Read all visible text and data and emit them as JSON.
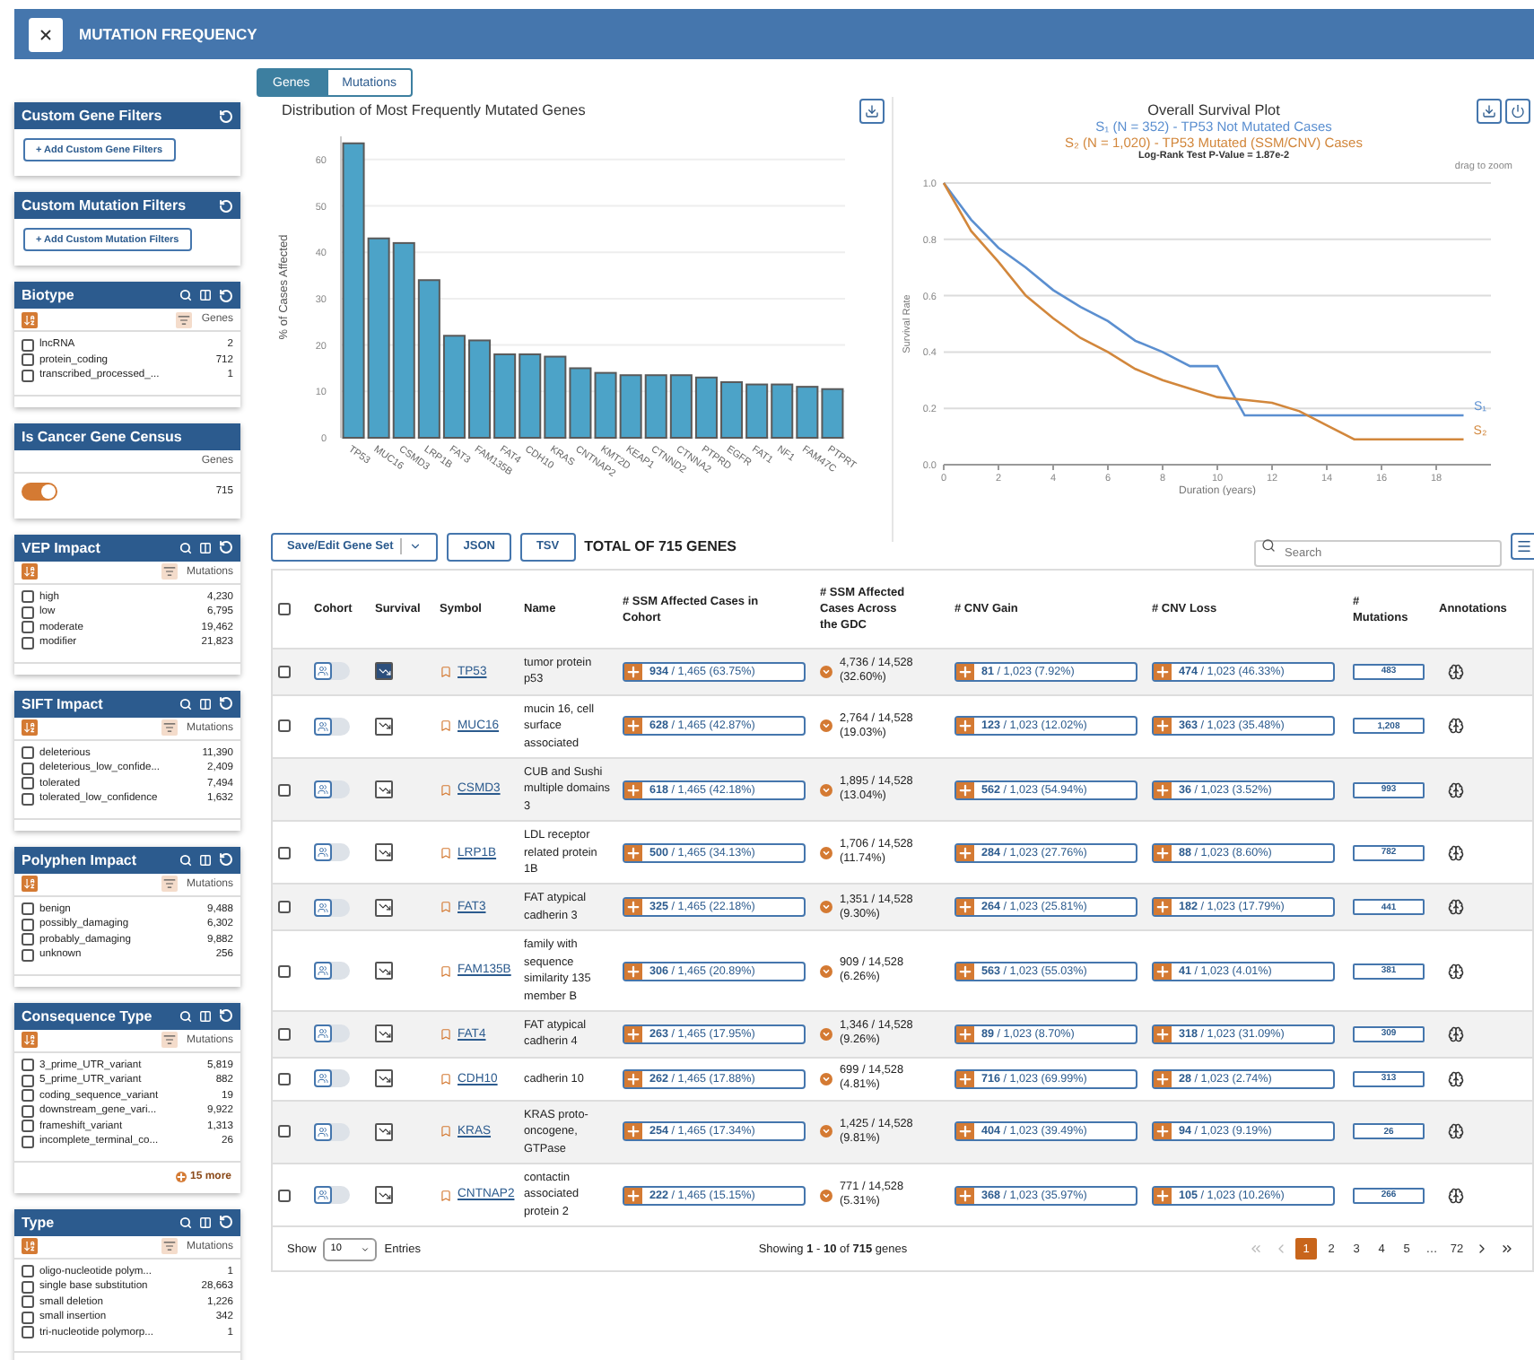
{
  "header": {
    "title": "MUTATION FREQUENCY"
  },
  "sidebar": {
    "cards": [
      {
        "kind": "custom",
        "title": "Custom Gene Filters",
        "button": "+ Add Custom Gene Filters"
      },
      {
        "kind": "custom",
        "title": "Custom Mutation Filters",
        "button": "+ Add Custom Mutation Filters"
      },
      {
        "kind": "facet",
        "title": "Biotype",
        "count_label": "Genes",
        "items": [
          {
            "label": "lncRNA",
            "count": "2",
            "checked": false
          },
          {
            "label": "protein_coding",
            "count": "712",
            "checked": false
          },
          {
            "label": "transcribed_processed_...",
            "count": "1",
            "checked": false
          }
        ]
      },
      {
        "kind": "toggle",
        "title": "Is Cancer Gene Census",
        "count_label": "Genes",
        "on": true,
        "count": "715"
      },
      {
        "kind": "facet",
        "title": "VEP Impact",
        "count_label": "Mutations",
        "items": [
          {
            "label": "high",
            "count": "4,230",
            "checked": false
          },
          {
            "label": "low",
            "count": "6,795",
            "checked": false
          },
          {
            "label": "moderate",
            "count": "19,462",
            "checked": false
          },
          {
            "label": "modifier",
            "count": "21,823",
            "checked": false
          }
        ]
      },
      {
        "kind": "facet",
        "title": "SIFT Impact",
        "count_label": "Mutations",
        "items": [
          {
            "label": "deleterious",
            "count": "11,390",
            "checked": false
          },
          {
            "label": "deleterious_low_confide...",
            "count": "2,409",
            "checked": false
          },
          {
            "label": "tolerated",
            "count": "7,494",
            "checked": false
          },
          {
            "label": "tolerated_low_confidence",
            "count": "1,632",
            "checked": false
          }
        ]
      },
      {
        "kind": "facet",
        "title": "Polyphen Impact",
        "count_label": "Mutations",
        "items": [
          {
            "label": "benign",
            "count": "9,488",
            "checked": false
          },
          {
            "label": "possibly_damaging",
            "count": "6,302",
            "checked": false
          },
          {
            "label": "probably_damaging",
            "count": "9,882",
            "checked": false
          },
          {
            "label": "unknown",
            "count": "256",
            "checked": false
          }
        ]
      },
      {
        "kind": "facet",
        "title": "Consequence Type",
        "count_label": "Mutations",
        "more": "15 more",
        "items": [
          {
            "label": "3_prime_UTR_variant",
            "count": "5,819",
            "checked": false
          },
          {
            "label": "5_prime_UTR_variant",
            "count": "882",
            "checked": false
          },
          {
            "label": "coding_sequence_variant",
            "count": "19",
            "checked": false
          },
          {
            "label": "downstream_gene_vari...",
            "count": "9,922",
            "checked": false
          },
          {
            "label": "frameshift_variant",
            "count": "1,313",
            "checked": false
          },
          {
            "label": "incomplete_terminal_co...",
            "count": "26",
            "checked": false
          }
        ]
      },
      {
        "kind": "facet",
        "title": "Type",
        "count_label": "Mutations",
        "items": [
          {
            "label": "oligo-nucleotide polym...",
            "count": "1",
            "checked": false
          },
          {
            "label": "single base substitution",
            "count": "28,663",
            "checked": false
          },
          {
            "label": "small deletion",
            "count": "1,226",
            "checked": false
          },
          {
            "label": "small insertion",
            "count": "342",
            "checked": false
          },
          {
            "label": "tri-nucleotide polymorp...",
            "count": "1",
            "checked": false
          }
        ]
      }
    ]
  },
  "view_tabs": [
    {
      "label": "Genes",
      "selected": true
    },
    {
      "label": "Mutations",
      "selected": false
    }
  ],
  "gene_chart": {
    "chart_data": {
      "type": "bar",
      "title": "Distribution of Most Frequently Mutated Genes",
      "ylabel": "% of Cases Affected",
      "categories": [
        "TP53",
        "MUC16",
        "CSMD3",
        "LRP1B",
        "FAT3",
        "FAM135B",
        "FAT4",
        "CDH10",
        "KRAS",
        "CNTNAP2",
        "KMT2D",
        "KEAP1",
        "CTNND2",
        "CTNNA2",
        "PTPRD",
        "EGFR",
        "FAT1",
        "NF1",
        "FAM47C",
        "PTPRT"
      ],
      "values": [
        63.5,
        43,
        42,
        34,
        22,
        21,
        18,
        18,
        17.5,
        15,
        14,
        13.5,
        13.5,
        13.5,
        13,
        12,
        11.5,
        11.5,
        11,
        10.5
      ],
      "ylim": [
        0,
        65
      ],
      "grid": true,
      "yticks": [
        0,
        10,
        20,
        30,
        40,
        50,
        60
      ]
    }
  },
  "survival": {
    "legend": [
      {
        "text": "S₁ (N = 352) - TP53 Not Mutated Cases",
        "color": "#5b8fd0"
      },
      {
        "text": "S₂ (N = 1,020) - TP53 Mutated (SSM/CNV) Cases",
        "color": "#d2873c"
      }
    ],
    "p_value": "Log-Rank Test P-Value = 1.87e-2",
    "hint": "drag to zoom",
    "chart_data": {
      "type": "line",
      "title": "Overall Survival Plot",
      "xlabel": "Duration (years)",
      "ylabel": "Survival Rate",
      "x": [
        0,
        1,
        2,
        3,
        4,
        5,
        6,
        7,
        8,
        9,
        10,
        11,
        12,
        13,
        14,
        15,
        16,
        17,
        18,
        19
      ],
      "series": [
        {
          "name": "S₁",
          "color": "#5b8fd0",
          "values": [
            1.0,
            0.87,
            0.77,
            0.7,
            0.62,
            0.56,
            0.51,
            0.44,
            0.4,
            0.35,
            0.35,
            0.175,
            0.175,
            0.175,
            0.175,
            0.175,
            0.175,
            0.175,
            0.175,
            0.175
          ]
        },
        {
          "name": "S₂",
          "color": "#d2873c",
          "values": [
            1.0,
            0.83,
            0.72,
            0.6,
            0.52,
            0.45,
            0.4,
            0.34,
            0.3,
            0.27,
            0.24,
            0.23,
            0.22,
            0.19,
            0.14,
            0.09,
            0.09,
            0.09,
            0.09,
            0.09
          ]
        }
      ],
      "xlim": [
        0,
        20
      ],
      "ylim": [
        0,
        1
      ],
      "grid": true,
      "xticks": [
        0,
        2,
        4,
        6,
        8,
        10,
        12,
        14,
        16,
        18
      ],
      "yticks": [
        {
          "value": 0,
          "label": "0.0"
        },
        {
          "value": 0.2,
          "label": "0.2"
        },
        {
          "value": 0.4,
          "label": "0.4"
        },
        {
          "value": 0.6,
          "label": "0.6"
        },
        {
          "value": 0.8,
          "label": "0.8"
        },
        {
          "value": 1,
          "label": "1.0"
        }
      ]
    }
  },
  "toolbar": {
    "gene_set_button": "Save/Edit Gene Set",
    "buttons": [
      "JSON",
      "TSV"
    ],
    "total": "TOTAL OF 715 GENES",
    "search": {
      "placeholder": "Search"
    }
  },
  "table": {
    "all_selected": false,
    "columns": [
      "Cohort",
      "Survival",
      "Symbol",
      "Name",
      "# SSM Affected Cases in Cohort",
      "# SSM Affected Cases Across the GDC",
      "# CNV Gain",
      "# CNV Loss",
      "# Mutations",
      "Annotations"
    ],
    "rows": [
      {
        "selected": false,
        "in_cohort": false,
        "survival_selected": true,
        "symbol": "TP53",
        "name": "tumor protein p53",
        "ssm": "**934** / 1,465 (63.75%)",
        "gdc": "4,736 / 14,528",
        "gdc_percent": "(32.60%)",
        "cnv_gain": "**81** / 1,023 (7.92%)",
        "cnv_loss": "**474** / 1,023 (46.33%)",
        "mutations": "483"
      },
      {
        "selected": false,
        "in_cohort": false,
        "survival_selected": false,
        "symbol": "MUC16",
        "name": "mucin 16, cell surface associated",
        "ssm": "**628** / 1,465 (42.87%)",
        "gdc": "2,764 / 14,528",
        "gdc_percent": "(19.03%)",
        "cnv_gain": "**123** / 1,023 (12.02%)",
        "cnv_loss": "**363** / 1,023 (35.48%)",
        "mutations": "1,208"
      },
      {
        "selected": false,
        "in_cohort": false,
        "survival_selected": false,
        "symbol": "CSMD3",
        "name": "CUB and Sushi multiple domains 3",
        "ssm": "**618** / 1,465 (42.18%)",
        "gdc": "1,895 / 14,528",
        "gdc_percent": "(13.04%)",
        "cnv_gain": "**562** / 1,023 (54.94%)",
        "cnv_loss": "**36** / 1,023 (3.52%)",
        "mutations": "993"
      },
      {
        "selected": false,
        "in_cohort": false,
        "survival_selected": false,
        "symbol": "LRP1B",
        "name": "LDL receptor related protein 1B",
        "ssm": "**500** / 1,465 (34.13%)",
        "gdc": "1,706 / 14,528",
        "gdc_percent": "(11.74%)",
        "cnv_gain": "**284** / 1,023 (27.76%)",
        "cnv_loss": "**88** / 1,023 (8.60%)",
        "mutations": "782"
      },
      {
        "selected": false,
        "in_cohort": false,
        "survival_selected": false,
        "symbol": "FAT3",
        "name": "FAT atypical cadherin 3",
        "ssm": "**325** / 1,465 (22.18%)",
        "gdc": "1,351 / 14,528",
        "gdc_percent": "(9.30%)",
        "cnv_gain": "**264** / 1,023 (25.81%)",
        "cnv_loss": "**182** / 1,023 (17.79%)",
        "mutations": "441"
      },
      {
        "selected": false,
        "in_cohort": false,
        "survival_selected": false,
        "symbol": "FAM135B",
        "name": "family with sequence similarity 135 member B",
        "ssm": "**306** / 1,465 (20.89%)",
        "gdc": "909 / 14,528",
        "gdc_percent": "(6.26%)",
        "cnv_gain": "**563** / 1,023 (55.03%)",
        "cnv_loss": "**41** / 1,023 (4.01%)",
        "mutations": "381"
      },
      {
        "selected": false,
        "in_cohort": false,
        "survival_selected": false,
        "symbol": "FAT4",
        "name": "FAT atypical cadherin 4",
        "ssm": "**263** / 1,465 (17.95%)",
        "gdc": "1,346 / 14,528",
        "gdc_percent": "(9.26%)",
        "cnv_gain": "**89** / 1,023 (8.70%)",
        "cnv_loss": "**318** / 1,023 (31.09%)",
        "mutations": "309"
      },
      {
        "selected": false,
        "in_cohort": false,
        "survival_selected": false,
        "symbol": "CDH10",
        "name": "cadherin 10",
        "ssm": "**262** / 1,465 (17.88%)",
        "gdc": "699 / 14,528",
        "gdc_percent": "(4.81%)",
        "cnv_gain": "**716** / 1,023 (69.99%)",
        "cnv_loss": "**28** / 1,023 (2.74%)",
        "mutations": "313"
      },
      {
        "selected": false,
        "in_cohort": false,
        "survival_selected": false,
        "symbol": "KRAS",
        "name": "KRAS proto-oncogene, GTPase",
        "ssm": "**254** / 1,465 (17.34%)",
        "gdc": "1,425 / 14,528",
        "gdc_percent": "(9.81%)",
        "cnv_gain": "**404** / 1,023 (39.49%)",
        "cnv_loss": "**94** / 1,023 (9.19%)",
        "mutations": "26"
      },
      {
        "selected": false,
        "in_cohort": false,
        "survival_selected": false,
        "symbol": "CNTNAP2",
        "name": "contactin associated protein 2",
        "ssm": "**222** / 1,465 (15.15%)",
        "gdc": "771 / 14,528",
        "gdc_percent": "(5.31%)",
        "cnv_gain": "**368** / 1,023 (35.97%)",
        "cnv_loss": "**105** / 1,023 (10.26%)",
        "mutations": "266"
      }
    ]
  },
  "footer": {
    "show_label": "Show",
    "page_size": "10",
    "entries_label": "Entries",
    "showing": "Showing **1** - **10** of **715** genes",
    "pages": [
      {
        "label": "1",
        "selected": true
      },
      {
        "label": "2",
        "selected": false
      },
      {
        "label": "3",
        "selected": false
      },
      {
        "label": "4",
        "selected": false
      },
      {
        "label": "5",
        "selected": false
      },
      {
        "label": "…",
        "selected": false
      },
      {
        "label": "72",
        "selected": false
      }
    ],
    "first_disabled": true,
    "last_disabled": false
  }
}
